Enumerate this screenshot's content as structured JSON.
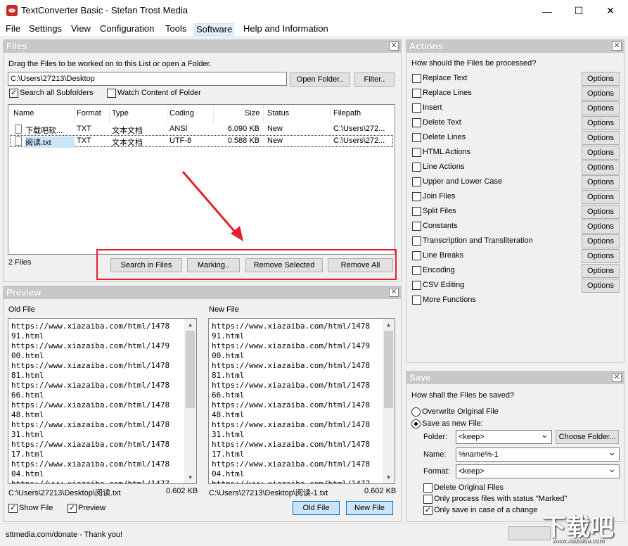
{
  "window": {
    "title": "TextConverter Basic - Stefan Trost Media",
    "minimize": "—",
    "maximize": "☐",
    "close": "✕"
  },
  "menu": [
    "File",
    "Settings",
    "View",
    "Configuration",
    "Tools",
    "Software",
    "Help and Information"
  ],
  "files_panel": {
    "title": "Files",
    "hint": "Drag the Files to be worked on to this List or open a Folder.",
    "path": "C:\\Users\\27213\\Desktop",
    "open_folder": "Open Folder..",
    "filter": "Filter..",
    "search_subfolders": "Search all Subfolders",
    "watch_content": "Watch Content of Folder",
    "columns": [
      "Name",
      "Format",
      "Type",
      "Coding",
      "Size",
      "Status",
      "Filepath"
    ],
    "rows": [
      [
        "下载吧软...",
        "TXT",
        "文本文档",
        "ANSI",
        "6.090 KB",
        "New",
        "C:\\Users\\272..."
      ],
      [
        "阅读.txt",
        "TXT",
        "文本文档",
        "UTF-8",
        "0.588 KB",
        "New",
        "C:\\Users\\272..."
      ]
    ],
    "count": "2 Files",
    "search_in_files": "Search in Files",
    "marking": "Marking..",
    "remove_selected": "Remove Selected",
    "remove_all": "Remove All"
  },
  "preview_panel": {
    "title": "Preview",
    "old_file_label": "Old File",
    "new_file_label": "New File",
    "lines": [
      "https://www.xiazaiba.com/html/1478",
      "91.html",
      "https://www.xiazaiba.com/html/1479",
      "00.html",
      "https://www.xiazaiba.com/html/1478",
      "81.html",
      "https://www.xiazaiba.com/html/1478",
      "66.html",
      "https://www.xiazaiba.com/html/1478",
      "48.html",
      "https://www.xiazaiba.com/html/1478",
      "31.html",
      "https://www.xiazaiba.com/html/1478",
      "17.html",
      "https://www.xiazaiba.com/html/1478",
      "04.html",
      "https://www.xiazaiba.com/html/1477"
    ],
    "old_path": "C:\\Users\\27213\\Desktop\\阅读.txt",
    "old_size": "0.602 KB",
    "new_path": "C:\\Users\\27213\\Desktop\\阅读-1.txt",
    "new_size": "0.602 KB",
    "show_file": "Show File",
    "preview": "Preview",
    "old_file_btn": "Old File",
    "new_file_btn": "New File"
  },
  "actions_panel": {
    "title": "Actions",
    "question": "How should the Files be processed?",
    "options_label": "Options",
    "items": [
      "Replace Text",
      "Replace Lines",
      "Insert",
      "Delete Text",
      "Delete Lines",
      "HTML Actions",
      "Line Actions",
      "Upper and Lower Case",
      "Join Files",
      "Split Files",
      "Constants",
      "Transcription and Transliteration",
      "Line Breaks",
      "Encoding",
      "CSV Editing",
      "More Functions"
    ]
  },
  "save_panel": {
    "title": "Save",
    "question": "How shall the Files be saved?",
    "overwrite": "Overwrite Original File",
    "save_new": "Save as new File:",
    "folder_label": "Folder:",
    "folder_value": "<keep>",
    "choose_folder": "Choose Folder...",
    "name_label": "Name:",
    "name_value": "%name%-1",
    "format_label": "Format:",
    "format_value": "<keep>",
    "delete_original": "Delete Original Files",
    "only_marked": "Only process files with status \"Marked\"",
    "only_change": "Only save in case of a change"
  },
  "status_bar": {
    "text": "sttmedia.com/donate - Thank you!"
  },
  "watermark": {
    "brand": "下载吧",
    "url": "www.xiazaiba.com"
  },
  "colors": {
    "annotation": "#e5202e",
    "panel_header": "#c8c8c8",
    "selected_button": "#cce4f7"
  }
}
